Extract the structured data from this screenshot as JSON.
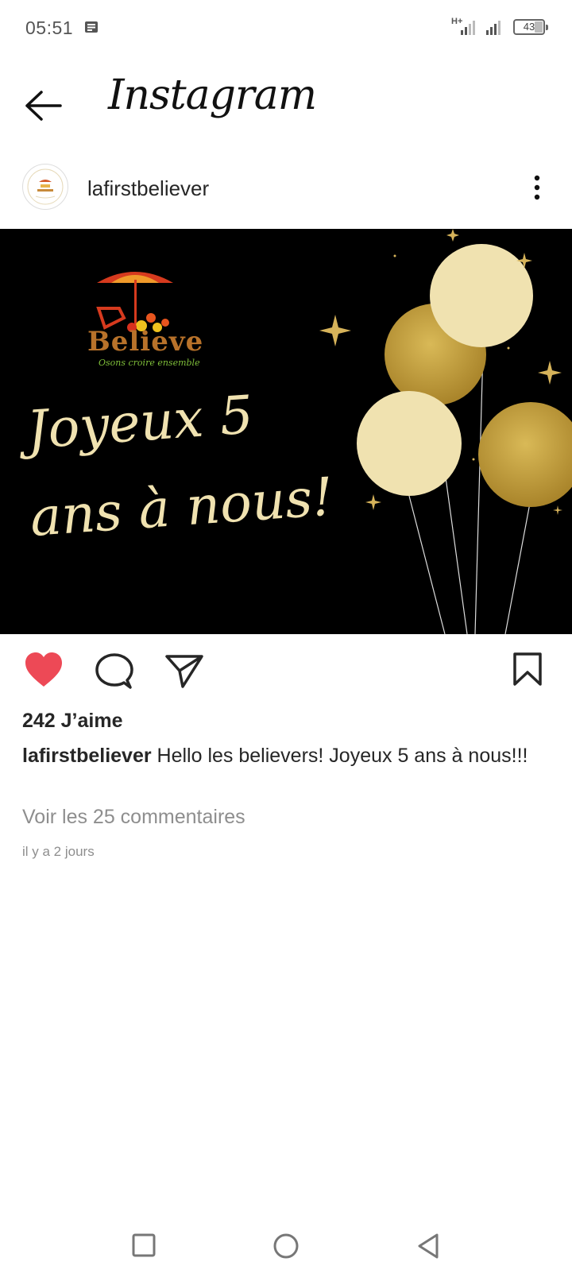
{
  "status_bar": {
    "time": "05:51",
    "network": "H+",
    "battery": "43",
    "icons": [
      "message-notification-icon",
      "signal-icon",
      "signal-icon",
      "battery-icon"
    ]
  },
  "header": {
    "back_icon": "arrow-left-icon",
    "title": "Instagram"
  },
  "post": {
    "username": "lafirstbeliever",
    "more_icon": "more-vertical-icon",
    "image": {
      "logo_text": "Believe",
      "logo_tagline": "Osons croire ensemble",
      "line1": "Joyeux 5",
      "line2": "ans à nous!"
    },
    "actions": {
      "like_icon": "heart-filled-icon",
      "comment_icon": "comment-icon",
      "share_icon": "paper-plane-icon",
      "save_icon": "bookmark-icon",
      "like_color": "#ed4956"
    },
    "likes": "242 J’aime",
    "caption_username": "lafirstbeliever",
    "caption_text": " Hello les believers! Joyeux 5 ans à nous!!!",
    "comments_link": "Voir les 25 commentaires",
    "time_ago": "il y a 2 jours"
  },
  "nav_bar": {
    "icons": [
      "square-recents-icon",
      "circle-home-icon",
      "triangle-back-icon"
    ]
  },
  "colors": {
    "image_background": "#000000",
    "gold": "#c9a53c",
    "cream": "#f0e2b0",
    "secondary_text": "#8e8e8e"
  }
}
